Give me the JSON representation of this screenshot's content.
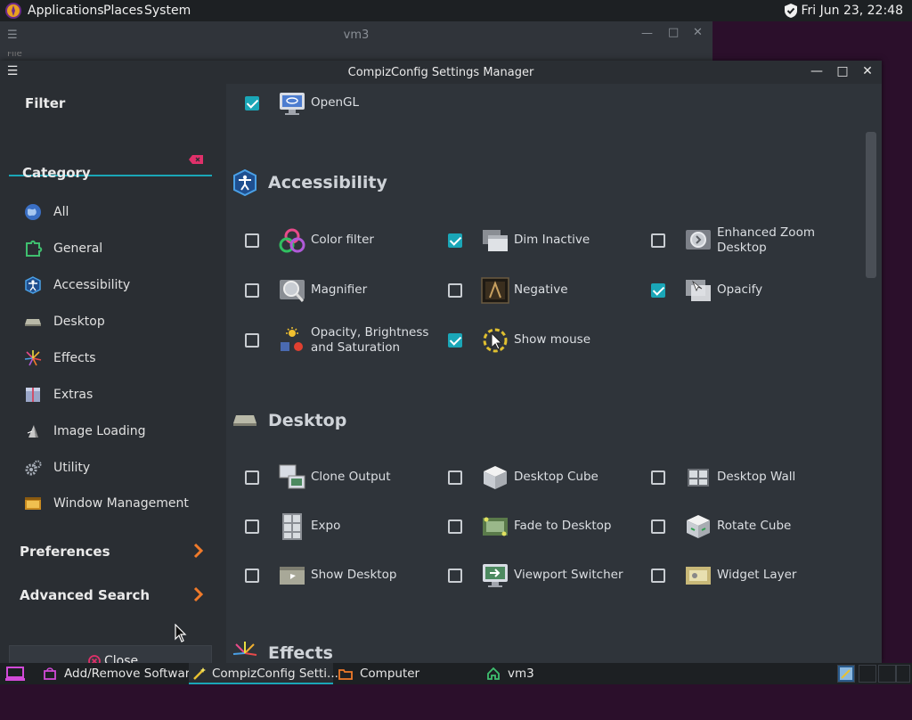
{
  "top_panel": {
    "menus": [
      "Applications",
      "Places",
      "System"
    ],
    "clock": "Fri Jun 23, 22:48"
  },
  "background_window": {
    "title": "vm3",
    "menu_hint": "File"
  },
  "window": {
    "title": "CompizConfig Settings Manager"
  },
  "sidebar": {
    "filter_label": "Filter",
    "filter_value": "",
    "category_label": "Category",
    "categories": [
      {
        "label": "All",
        "icon": "globe-icon"
      },
      {
        "label": "General",
        "icon": "puzzle-icon"
      },
      {
        "label": "Accessibility",
        "icon": "accessibility-icon"
      },
      {
        "label": "Desktop",
        "icon": "desktop-icon"
      },
      {
        "label": "Effects",
        "icon": "fireworks-icon"
      },
      {
        "label": "Extras",
        "icon": "extras-icon"
      },
      {
        "label": "Image Loading",
        "icon": "image-loading-icon"
      },
      {
        "label": "Utility",
        "icon": "gears-icon"
      },
      {
        "label": "Window Management",
        "icon": "window-management-icon"
      }
    ],
    "preferences_label": "Preferences",
    "advanced_search_label": "Advanced Search",
    "close_label": "Close"
  },
  "content": {
    "top_plugin": {
      "label": "OpenGL",
      "checked": true
    },
    "sections": [
      {
        "title": "Accessibility",
        "plugins": [
          {
            "label": "Color filter",
            "checked": false
          },
          {
            "label": "Dim Inactive",
            "checked": true
          },
          {
            "label": "Enhanced Zoom Desktop",
            "checked": false
          },
          {
            "label": "Magnifier",
            "checked": false
          },
          {
            "label": "Negative",
            "checked": false
          },
          {
            "label": "Opacify",
            "checked": true
          },
          {
            "label": "Opacity, Brightness and Saturation",
            "checked": false
          },
          {
            "label": "Show mouse",
            "checked": true
          }
        ]
      },
      {
        "title": "Desktop",
        "plugins": [
          {
            "label": "Clone Output",
            "checked": false
          },
          {
            "label": "Desktop Cube",
            "checked": false
          },
          {
            "label": "Desktop Wall",
            "checked": false
          },
          {
            "label": "Expo",
            "checked": false
          },
          {
            "label": "Fade to Desktop",
            "checked": false
          },
          {
            "label": "Rotate Cube",
            "checked": false
          },
          {
            "label": "Show Desktop",
            "checked": false
          },
          {
            "label": "Viewport Switcher",
            "checked": false
          },
          {
            "label": "Widget Layer",
            "checked": false
          }
        ]
      },
      {
        "title": "Effects",
        "plugins": []
      }
    ]
  },
  "taskbar": {
    "tasks": [
      "Add/Remove Software",
      "CompizConfig Setti...",
      "Computer",
      "vm3"
    ]
  },
  "colors": {
    "accent": "#1aa6b7",
    "window_bg": "#2f343a",
    "sidebar_bg": "#2a2e33",
    "panel_bg": "#1d2023",
    "desktop_bg": "#2b0f2b",
    "arrow_orange": "#f07a2a"
  }
}
